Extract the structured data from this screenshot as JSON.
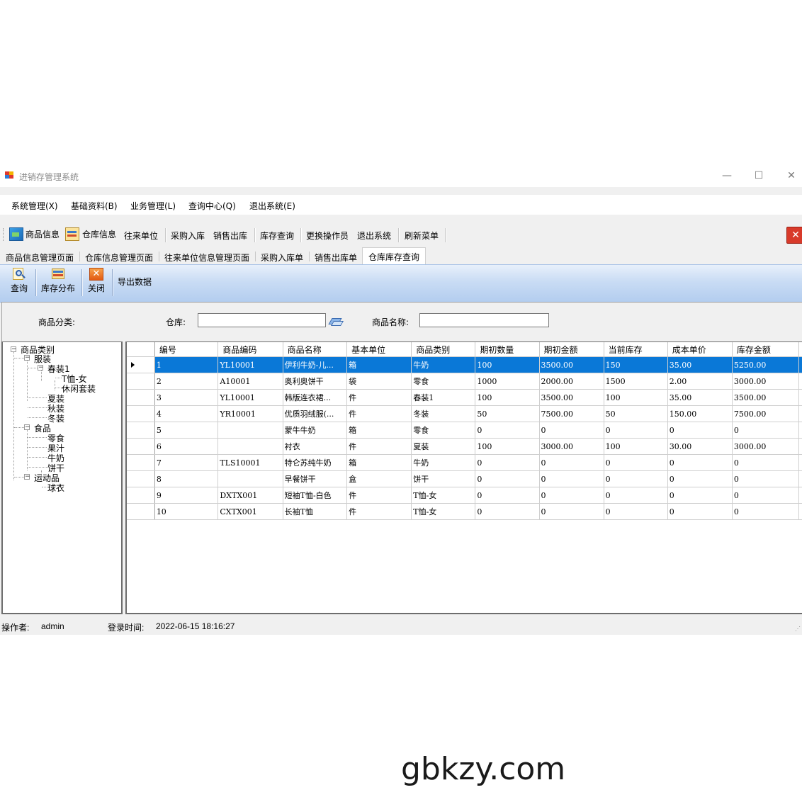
{
  "window": {
    "title": "进销存管理系统",
    "minimize": "—",
    "maximize": "☐",
    "close": "✕"
  },
  "menu": [
    "系统管理(X)",
    "基础资料(B)",
    "业务管理(L)",
    "查询中心(Q)",
    "退出系统(E)"
  ],
  "toolbar": {
    "items": [
      "商品信息",
      "仓库信息",
      "往来单位",
      "采购入库",
      "销售出库",
      "库存查询",
      "更换操作员",
      "退出系统",
      "刷新菜单"
    ],
    "close_glyph": "✕"
  },
  "tabs": [
    "商品信息管理页面",
    "仓库信息管理页面",
    "往来单位信息管理页面",
    "采购入库单",
    "销售出库单",
    "仓库库存查询"
  ],
  "active_tab": "仓库库存查询",
  "panel": {
    "query": "查询",
    "distribution": "库存分布",
    "close": "关闭",
    "export": "导出数据"
  },
  "filter": {
    "category_label": "商品分类:",
    "warehouse_label": "仓库:",
    "warehouse_value": "",
    "name_label": "商品名称:",
    "name_value": ""
  },
  "tree": {
    "root": "商品类别",
    "clothing": "服装",
    "spring": "春装1",
    "tshirt_female": "T恤-女",
    "casual_set": "休闲套装",
    "summer": "夏装",
    "autumn": "秋装",
    "winter": "冬装",
    "food": "食品",
    "snack": "零食",
    "juice": "果汁",
    "milk": "牛奶",
    "biscuit": "饼干",
    "sports": "运动品",
    "ball_wear": "球衣"
  },
  "grid": {
    "columns": [
      "编号",
      "商品编码",
      "商品名称",
      "基本单位",
      "商品类别",
      "期初数量",
      "期初金额",
      "当前库存",
      "成本单价",
      "库存金额"
    ],
    "rows": [
      [
        "1",
        "YL10001",
        "伊利牛奶-儿...",
        "箱",
        "牛奶",
        "100",
        "3500.00",
        "150",
        "35.00",
        "5250.00"
      ],
      [
        "2",
        "A10001",
        "奥利奥饼干",
        "袋",
        "零食",
        "1000",
        "2000.00",
        "1500",
        "2.00",
        "3000.00"
      ],
      [
        "3",
        "YL10001",
        "韩版连衣裙...",
        "件",
        "春装1",
        "100",
        "3500.00",
        "100",
        "35.00",
        "3500.00"
      ],
      [
        "4",
        "YR10001",
        "优质羽绒服(...",
        "件",
        "冬装",
        "50",
        "7500.00",
        "50",
        "150.00",
        "7500.00"
      ],
      [
        "5",
        "",
        "蒙牛牛奶",
        "箱",
        "零食",
        "0",
        "0",
        "0",
        "0",
        "0"
      ],
      [
        "6",
        "",
        "衬衣",
        "件",
        "夏装",
        "100",
        "3000.00",
        "100",
        "30.00",
        "3000.00"
      ],
      [
        "7",
        "TLS10001",
        "特仑苏纯牛奶",
        "箱",
        "牛奶",
        "0",
        "0",
        "0",
        "0",
        "0"
      ],
      [
        "8",
        "",
        "早餐饼干",
        "盒",
        "饼干",
        "0",
        "0",
        "0",
        "0",
        "0"
      ],
      [
        "9",
        "DXTX001",
        "短袖T恤-白色",
        "件",
        "T恤-女",
        "0",
        "0",
        "0",
        "0",
        "0"
      ],
      [
        "10",
        "CXTX001",
        "长袖T恤",
        "件",
        "T恤-女",
        "0",
        "0",
        "0",
        "0",
        "0"
      ]
    ],
    "selected_row": 0
  },
  "status": {
    "operator_label": "操作者:",
    "operator": "admin",
    "login_label": "登录时间:",
    "login_time": "2022-06-15 18:16:27"
  },
  "watermark": "gbkzy.com"
}
